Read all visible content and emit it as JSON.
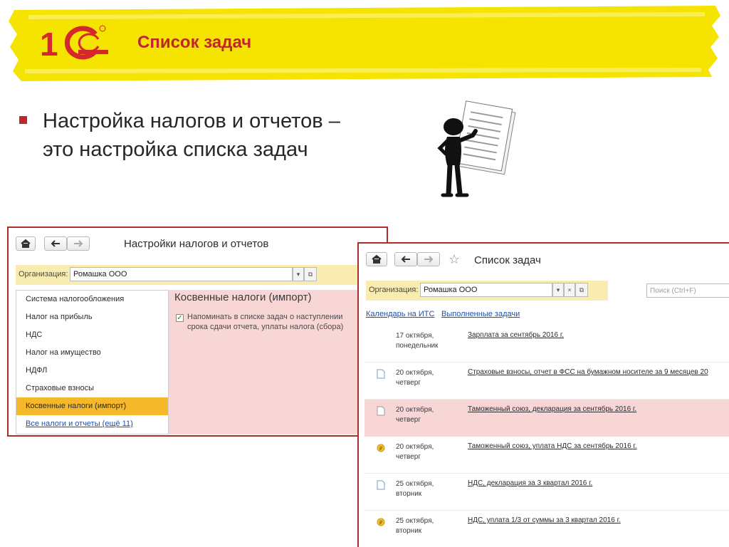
{
  "slide": {
    "title": "Список задач",
    "bullet_line1": "Настройка налогов и отчетов –",
    "bullet_line2": "это настройка списка задач"
  },
  "colors": {
    "accent": "#c0262d",
    "highlight": "#f5e400",
    "selected": "#f5b82a",
    "warn_bg": "#f8d6d6",
    "org_bg": "#f8ecb0"
  },
  "window1": {
    "title": "Настройки налогов и отчетов",
    "org_label": "Организация:",
    "org_value": "Ромашка ООО",
    "sidebar": [
      {
        "label": "Система налогообложения"
      },
      {
        "label": "Налог на прибыль"
      },
      {
        "label": "НДС"
      },
      {
        "label": "Налог на имущество"
      },
      {
        "label": "НДФЛ"
      },
      {
        "label": "Страховые взносы"
      },
      {
        "label": "Косвенные налоги (импорт)"
      }
    ],
    "all_link": "Все налоги и отчеты (ещё 11)",
    "pane_title": "Косвенные налоги (импорт)",
    "checkbox_checked": true,
    "checkbox_label": "Напоминать в списке задач о наступлении срока сдачи отчета, уплаты налога (сбора)"
  },
  "window2": {
    "title": "Список задач",
    "org_label": "Организация:",
    "org_value": "Ромашка ООО",
    "search_placeholder": "Поиск (Ctrl+F)",
    "links": [
      "Календарь на ИТС",
      "Выполненные задачи"
    ],
    "tasks": [
      {
        "date1": "17 октября,",
        "date2": "понедельник",
        "desc": "Зарплата за сентябрь 2016 г.",
        "icon": "none"
      },
      {
        "date1": "20 октября,",
        "date2": "четверг",
        "desc": "Страховые взносы, отчет в ФСС на бумажном носителе за 9 месяцев 20",
        "icon": "document-icon"
      },
      {
        "date1": "20 октября,",
        "date2": "четверг",
        "desc": "Таможенный союз, декларация за сентябрь 2016 г.",
        "icon": "document-icon"
      },
      {
        "date1": "20 октября,",
        "date2": "четверг",
        "desc": "Таможенный союз, уплата НДС за сентябрь 2016 г.",
        "icon": "coin-icon"
      },
      {
        "date1": "25 октября,",
        "date2": "вторник",
        "desc": "НДС, декларация за 3 квартал 2016 г.",
        "icon": "document-icon"
      },
      {
        "date1": "25 октября,",
        "date2": "вторник",
        "desc": "НДС, уплата 1/3 от суммы за 3 квартал 2016 г.",
        "icon": "coin-icon"
      }
    ]
  }
}
